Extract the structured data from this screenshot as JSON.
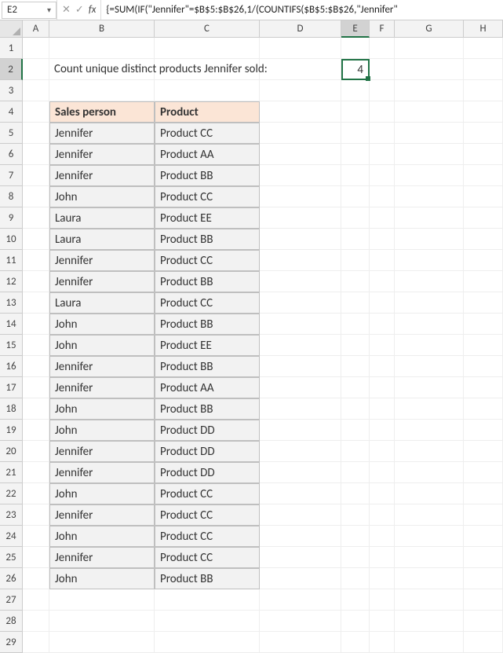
{
  "formula_bar": {
    "name_box": "E2",
    "formula": "{=SUM(IF(\"Jennifer\"=$B$5:$B$26,1/(COUNTIFS($B$5:$B$26,\"Jennifer\""
  },
  "columns": [
    "A",
    "B",
    "C",
    "D",
    "E",
    "F",
    "G",
    "H"
  ],
  "label_text": "Count unique distinct products  Jennifer sold:",
  "result_value": "4",
  "table": {
    "headers": {
      "col1": "Sales person",
      "col2": "Product"
    },
    "rows": [
      {
        "p": "Jennifer",
        "prod": "Product CC"
      },
      {
        "p": "Jennifer",
        "prod": "Product AA"
      },
      {
        "p": "Jennifer",
        "prod": "Product BB"
      },
      {
        "p": "John",
        "prod": "Product CC"
      },
      {
        "p": "Laura",
        "prod": "Product EE"
      },
      {
        "p": "Laura",
        "prod": "Product BB"
      },
      {
        "p": "Jennifer",
        "prod": "Product CC"
      },
      {
        "p": "Jennifer",
        "prod": "Product BB"
      },
      {
        "p": "Laura",
        "prod": "Product CC"
      },
      {
        "p": "John",
        "prod": "Product BB"
      },
      {
        "p": "John",
        "prod": "Product EE"
      },
      {
        "p": "Jennifer",
        "prod": "Product BB"
      },
      {
        "p": "Jennifer",
        "prod": "Product AA"
      },
      {
        "p": "John",
        "prod": "Product BB"
      },
      {
        "p": "John",
        "prod": "Product DD"
      },
      {
        "p": "Jennifer",
        "prod": "Product DD"
      },
      {
        "p": "Jennifer",
        "prod": "Product DD"
      },
      {
        "p": "John",
        "prod": "Product CC"
      },
      {
        "p": "Jennifer",
        "prod": "Product CC"
      },
      {
        "p": "John",
        "prod": "Product CC"
      },
      {
        "p": "Jennifer",
        "prod": "Product CC"
      },
      {
        "p": "John",
        "prod": "Product BB"
      }
    ]
  },
  "selected_cell": "E2",
  "colors": {
    "accent": "#217346",
    "header_bg": "#fbe5d6",
    "cell_bg": "#f2f2f2"
  }
}
